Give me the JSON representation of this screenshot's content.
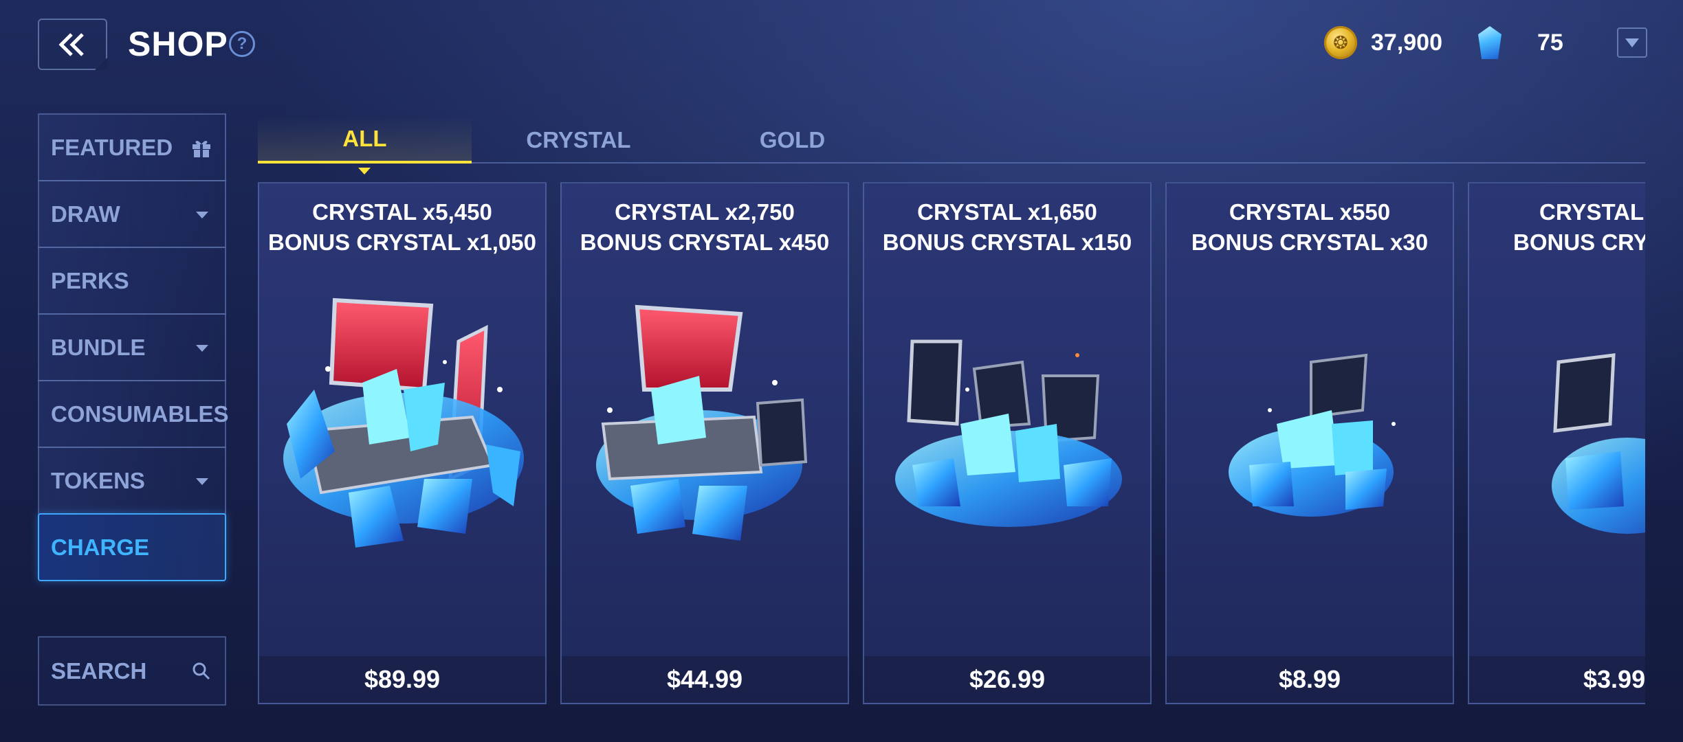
{
  "header": {
    "title": "SHOP",
    "help_symbol": "?",
    "gold_amount": "37,900",
    "crystal_amount": "75"
  },
  "sidebar": {
    "items": [
      {
        "label": "FEATURED"
      },
      {
        "label": "DRAW"
      },
      {
        "label": "PERKS"
      },
      {
        "label": "BUNDLE"
      },
      {
        "label": "CONSUMABLES"
      },
      {
        "label": "TOKENS"
      },
      {
        "label": "CHARGE"
      }
    ],
    "search_label": "SEARCH"
  },
  "tabs": [
    {
      "label": "ALL"
    },
    {
      "label": "CRYSTAL"
    },
    {
      "label": "GOLD"
    }
  ],
  "products": [
    {
      "line1": "CRYSTAL x5,450",
      "line2": "BONUS CRYSTAL x1,050",
      "price": "$89.99"
    },
    {
      "line1": "CRYSTAL x2,750",
      "line2": "BONUS CRYSTAL x450",
      "price": "$44.99"
    },
    {
      "line1": "CRYSTAL x1,650",
      "line2": "BONUS CRYSTAL x150",
      "price": "$26.99"
    },
    {
      "line1": "CRYSTAL x550",
      "line2": "BONUS CRYSTAL x30",
      "price": "$8.99"
    },
    {
      "line1": "CRYSTAL x",
      "line2": "BONUS CRYST",
      "price": "$3.99"
    }
  ],
  "colors": {
    "active_tab": "#ffe23a",
    "active_sidebar": "#3fb5ff",
    "inactive_text": "#8ea4d8"
  }
}
